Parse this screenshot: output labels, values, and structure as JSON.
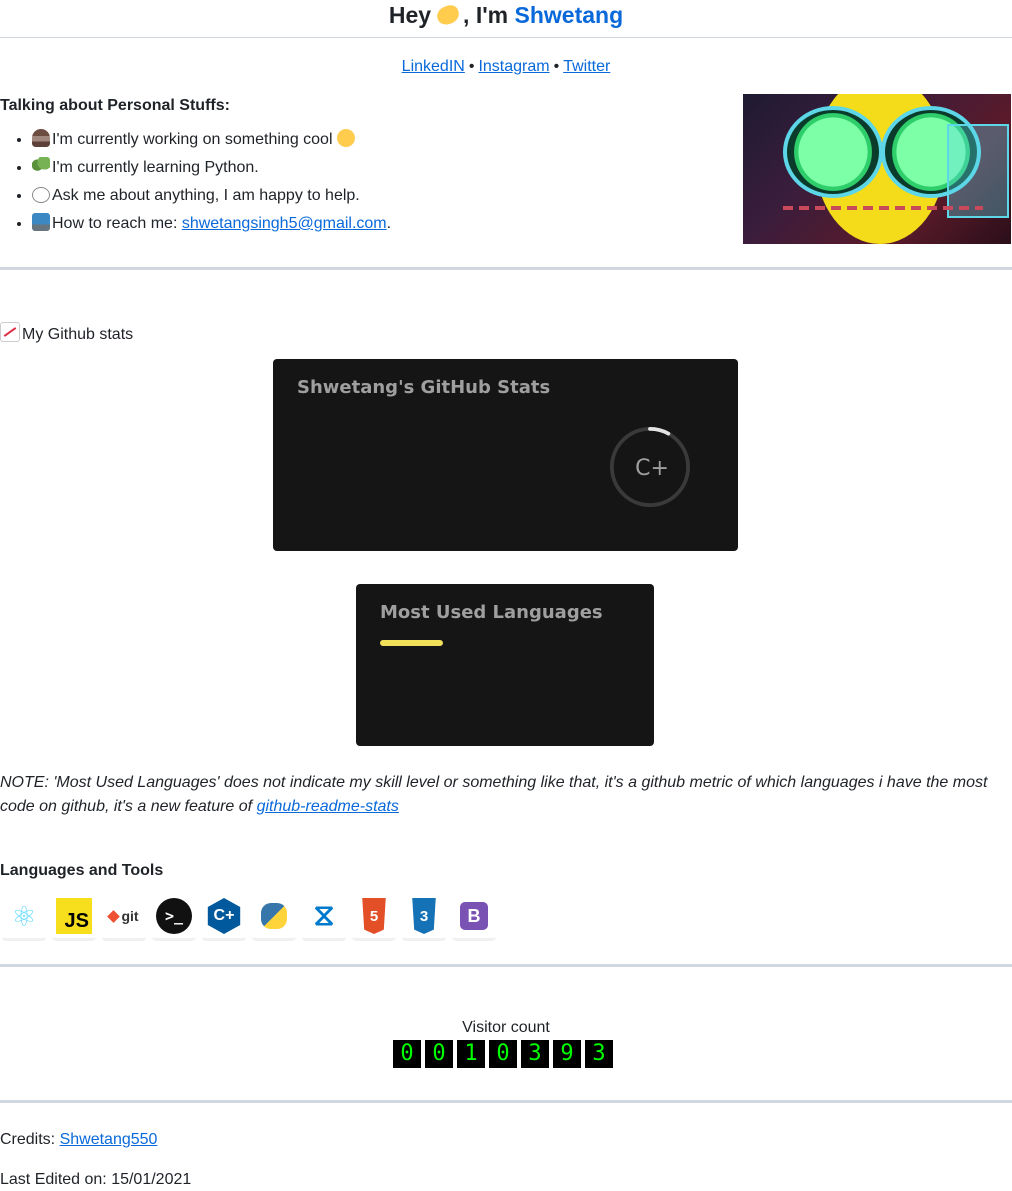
{
  "header": {
    "greeting": "Hey",
    "im": ", I'm",
    "name": "Shwetang"
  },
  "social_links": [
    {
      "label": "LinkedIN"
    },
    {
      "label": "Instagram"
    },
    {
      "label": "Twitter"
    }
  ],
  "separator": "•",
  "personal": {
    "heading": "Talking about Personal Stuffs:",
    "items": [
      {
        "icon": "coder-emoji-icon",
        "text": "I'm currently working on something cool"
      },
      {
        "icon": "seedling-emoji-icon",
        "text": "I'm currently learning Python."
      },
      {
        "icon": "speech-bubble-emoji-icon",
        "text": "Ask me about anything, I am happy to help."
      },
      {
        "icon": "mailbox-emoji-icon",
        "text": "How to reach me: ",
        "email": "shwetangsingh5@gmail.com",
        "suffix": "."
      }
    ]
  },
  "github_stats": {
    "heading": "My Github stats",
    "stats_card_title": "Shwetang's GitHub Stats",
    "rank": "C+",
    "rank_progress": 0.08,
    "languages_card_title": "Most Used Languages",
    "languages": [
      {
        "color": "#f1e05a"
      }
    ]
  },
  "note": {
    "text": "NOTE: 'Most Used Languages' does not indicate my skill level or something like that, it's a github metric of which languages i have the most code on github, it's a new feature of ",
    "link": "github-readme-stats"
  },
  "tools": {
    "heading": "Languages and Tools",
    "items": [
      {
        "icon": "react-icon",
        "glyph": "⚛"
      },
      {
        "icon": "javascript-icon",
        "glyph": "JS"
      },
      {
        "icon": "git-icon",
        "glyph": "git"
      },
      {
        "icon": "terminal-icon",
        "glyph": ">_"
      },
      {
        "icon": "cplusplus-icon",
        "glyph": "C+"
      },
      {
        "icon": "python-icon",
        "glyph": ""
      },
      {
        "icon": "vscode-icon",
        "glyph": "⧖"
      },
      {
        "icon": "html5-icon",
        "glyph": "5"
      },
      {
        "icon": "css3-icon",
        "glyph": "3"
      },
      {
        "icon": "bootstrap-icon",
        "glyph": "B"
      }
    ]
  },
  "visitor": {
    "label": "Visitor count",
    "digits": [
      "0",
      "0",
      "1",
      "0",
      "3",
      "9",
      "3"
    ]
  },
  "footer": {
    "credits_label": "Credits: ",
    "credits_link": "Shwetang550",
    "edited": "Last Edited on: 15/01/2021"
  },
  "colors": {
    "link": "#0969da",
    "card_bg": "#151515",
    "card_title": "#9f9f9f",
    "counter_digit": "#00ff00"
  }
}
